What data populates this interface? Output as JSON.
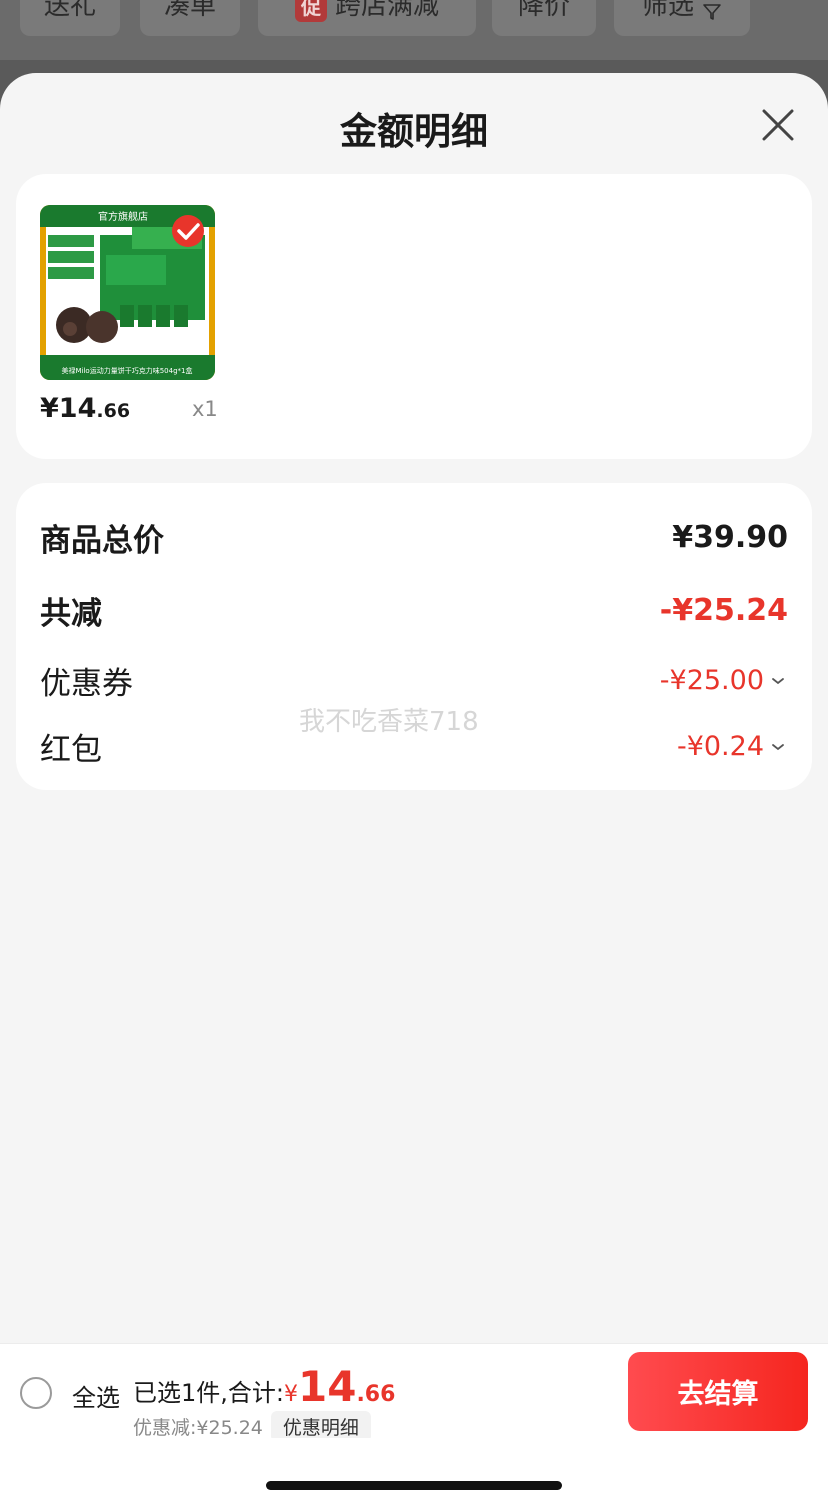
{
  "filter_bar": {
    "chips": [
      "送礼",
      "凑单",
      "跨店满减",
      "降价",
      "筛选"
    ],
    "promo_tag": "促"
  },
  "sheet": {
    "title": "金额明细",
    "close_icon": "close-icon"
  },
  "product": {
    "image_text": "官方旗舰店",
    "image_caption": "美禄Milo运动力量饼干巧克力味504g*1盒",
    "price_main": "¥14",
    "price_cents": ".66",
    "quantity": "x1",
    "selected": true
  },
  "summary": {
    "total_label": "商品总价",
    "total_value": "¥39.90",
    "discount_label": "共减",
    "discount_value": "-¥25.24",
    "coupon_label": "优惠券",
    "coupon_value": "-¥25.00",
    "redpacket_label": "红包",
    "redpacket_value": "-¥0.24",
    "watermark": "我不吃香菜718"
  },
  "bottom_bar": {
    "select_all": "全选",
    "total_prefix": "已选1件,合计:",
    "currency": "¥",
    "total_int": "14",
    "total_dec": ".66",
    "saved": "优惠减:¥25.24",
    "detail_button": "优惠明细",
    "checkout": "去结算"
  },
  "colors": {
    "accent_red": "#e8352b",
    "sheet_bg": "#f5f5f5"
  }
}
